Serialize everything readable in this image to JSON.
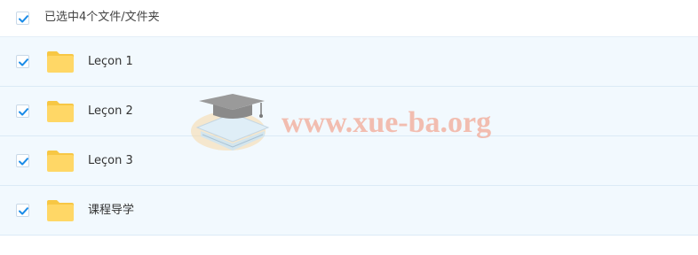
{
  "selection": {
    "label": "已选中4个文件/文件夹",
    "checked": true
  },
  "items": [
    {
      "name": "Leçon 1",
      "type": "folder",
      "checked": true,
      "icon": "folder-icon"
    },
    {
      "name": "Leçon 2",
      "type": "folder",
      "checked": true,
      "icon": "folder-icon"
    },
    {
      "name": "Leçon 3",
      "type": "folder",
      "checked": true,
      "icon": "folder-icon"
    },
    {
      "name": "课程导学",
      "type": "folder",
      "checked": true,
      "icon": "folder-icon"
    }
  ],
  "watermark": {
    "text": "www.xue-ba.org",
    "icon": "graduation-cap-icon"
  },
  "colors": {
    "checkmark": "#1a8ce8",
    "row_background": "#f2f9fe",
    "folder": "#ffd766",
    "folder_tab": "#f7c744",
    "watermark_text": "#f3b3a3"
  }
}
